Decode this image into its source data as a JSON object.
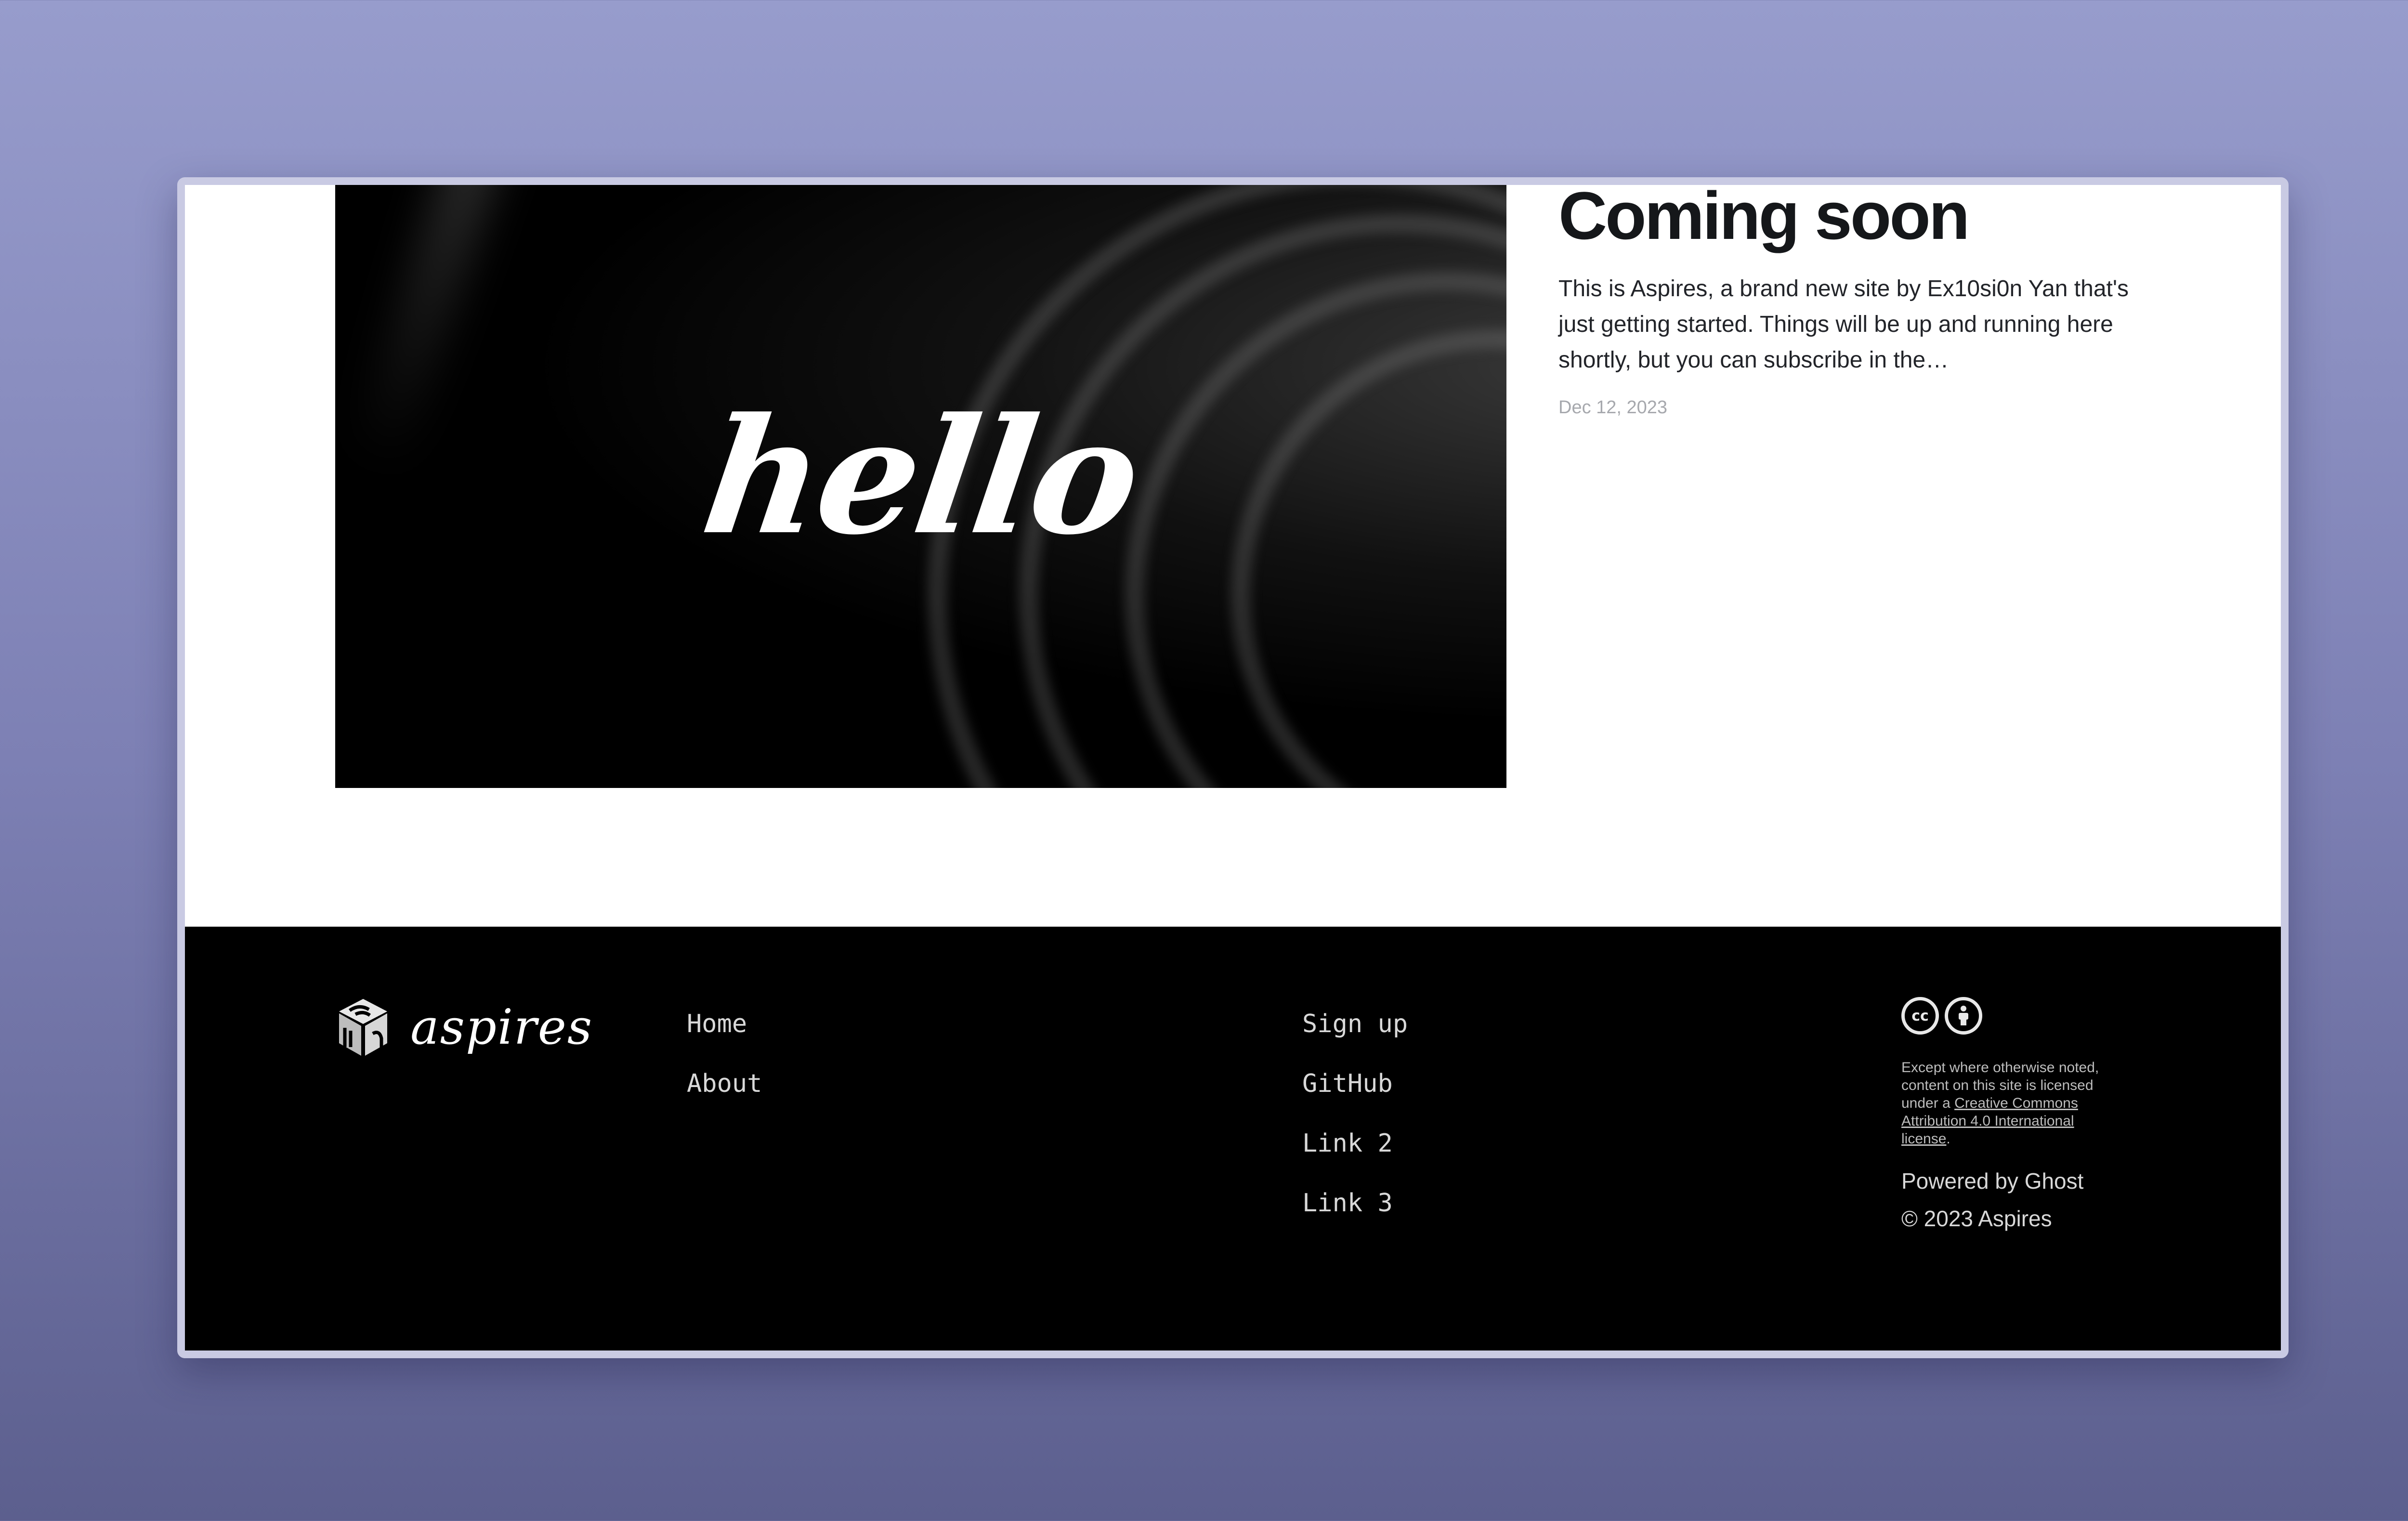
{
  "hero": {
    "text": "hello"
  },
  "post": {
    "title": "Coming soon",
    "excerpt": "This is Aspires, a brand new site by Ex10si0n Yan that's just getting started. Things will be up and running here shortly, but you can subscribe in the…",
    "date": "Dec 12, 2023"
  },
  "footer": {
    "brand_name": "aspires",
    "nav_primary": [
      {
        "label": "Home"
      },
      {
        "label": "About"
      }
    ],
    "nav_secondary": [
      {
        "label": "Sign up"
      },
      {
        "label": "GitHub"
      },
      {
        "label": "Link 2"
      },
      {
        "label": "Link 3"
      }
    ],
    "license": {
      "cc_icon": "cc-icon",
      "by_icon": "attribution-icon",
      "text_before": "Except where otherwise noted, content on this site is licensed under a ",
      "link_text": "Creative Commons Attribution 4.0 International license",
      "text_after": "."
    },
    "powered_by": "Powered by Ghost",
    "copyright": "© 2023 Aspires"
  },
  "colors": {
    "background_top": "#979ccc",
    "background_bottom": "#5c5f8e",
    "footer_bg": "#000000",
    "title": "#15171a"
  }
}
